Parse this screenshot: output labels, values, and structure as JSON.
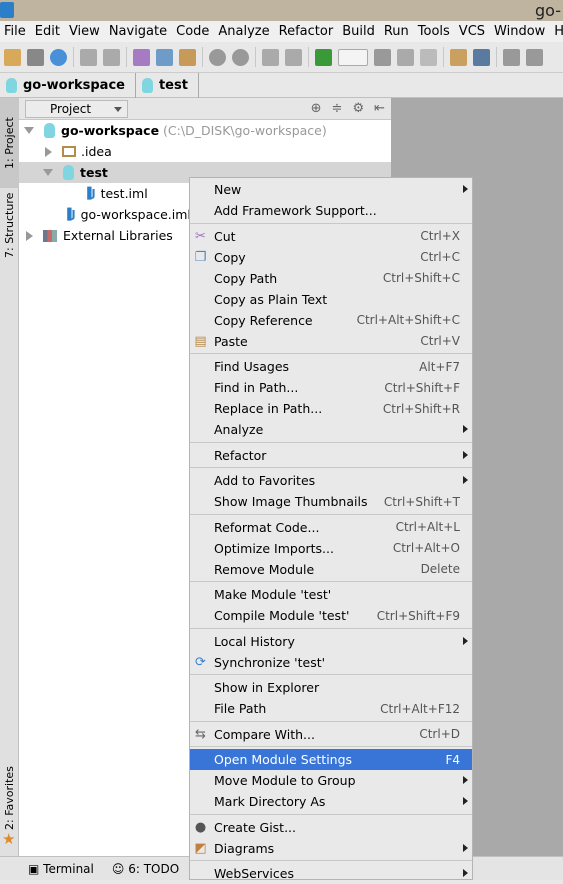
{
  "window": {
    "title": "go-"
  },
  "menubar": [
    "File",
    "Edit",
    "View",
    "Navigate",
    "Code",
    "Analyze",
    "Refactor",
    "Build",
    "Run",
    "Tools",
    "VCS",
    "Window",
    "He"
  ],
  "breadcrumb": [
    "go-workspace",
    "test"
  ],
  "tool_tabs": {
    "project": "1: Project",
    "structure": "7: Structure",
    "favorites": "2: Favorites"
  },
  "panel": {
    "selector": "Project"
  },
  "tree": {
    "root": {
      "name": "go-workspace",
      "path": "(C:\\D_DISK\\go-workspace)"
    },
    "idea": ".idea",
    "test": "test",
    "test_iml": "test.iml",
    "ws_iml": "go-workspace.iml",
    "libs": "External Libraries"
  },
  "bottom": {
    "terminal": "Terminal",
    "todo": "6: TODO"
  },
  "menu": [
    [
      {
        "label": "New",
        "submenu": true
      },
      {
        "label": "Add Framework Support..."
      }
    ],
    [
      {
        "label": "Cut",
        "shortcut": "Ctrl+X",
        "icon": "scissors-icon"
      },
      {
        "label": "Copy",
        "shortcut": "Ctrl+C",
        "icon": "copy-icon"
      },
      {
        "label": "Copy Path",
        "shortcut": "Ctrl+Shift+C"
      },
      {
        "label": "Copy as Plain Text"
      },
      {
        "label": "Copy Reference",
        "shortcut": "Ctrl+Alt+Shift+C"
      },
      {
        "label": "Paste",
        "shortcut": "Ctrl+V",
        "icon": "paste-icon"
      }
    ],
    [
      {
        "label": "Find Usages",
        "shortcut": "Alt+F7"
      },
      {
        "label": "Find in Path...",
        "shortcut": "Ctrl+Shift+F"
      },
      {
        "label": "Replace in Path...",
        "shortcut": "Ctrl+Shift+R"
      },
      {
        "label": "Analyze",
        "submenu": true
      }
    ],
    [
      {
        "label": "Refactor",
        "submenu": true
      }
    ],
    [
      {
        "label": "Add to Favorites",
        "submenu": true
      },
      {
        "label": "Show Image Thumbnails",
        "shortcut": "Ctrl+Shift+T"
      }
    ],
    [
      {
        "label": "Reformat Code...",
        "shortcut": "Ctrl+Alt+L"
      },
      {
        "label": "Optimize Imports...",
        "shortcut": "Ctrl+Alt+O"
      },
      {
        "label": "Remove Module",
        "shortcut": "Delete"
      }
    ],
    [
      {
        "label": "Make Module 'test'"
      },
      {
        "label": "Compile Module 'test'",
        "shortcut": "Ctrl+Shift+F9"
      }
    ],
    [
      {
        "label": "Local History",
        "submenu": true
      },
      {
        "label": "Synchronize 'test'",
        "icon": "sync-icon"
      }
    ],
    [
      {
        "label": "Show in Explorer"
      },
      {
        "label": "File Path",
        "shortcut": "Ctrl+Alt+F12"
      }
    ],
    [
      {
        "label": "Compare With...",
        "shortcut": "Ctrl+D",
        "icon": "compare-icon"
      }
    ],
    [
      {
        "label": "Open Module Settings",
        "shortcut": "F4",
        "highlighted": true
      },
      {
        "label": "Move Module to Group",
        "submenu": true
      },
      {
        "label": "Mark Directory As",
        "submenu": true
      }
    ],
    [
      {
        "label": "Create Gist...",
        "icon": "github-icon"
      },
      {
        "label": "Diagrams",
        "submenu": true,
        "icon": "diagram-icon"
      }
    ],
    [
      {
        "label": "WebServices",
        "submenu": true
      }
    ]
  ],
  "colors": {
    "highlight": "#3875d7",
    "titlebar": "#bfb49f"
  }
}
